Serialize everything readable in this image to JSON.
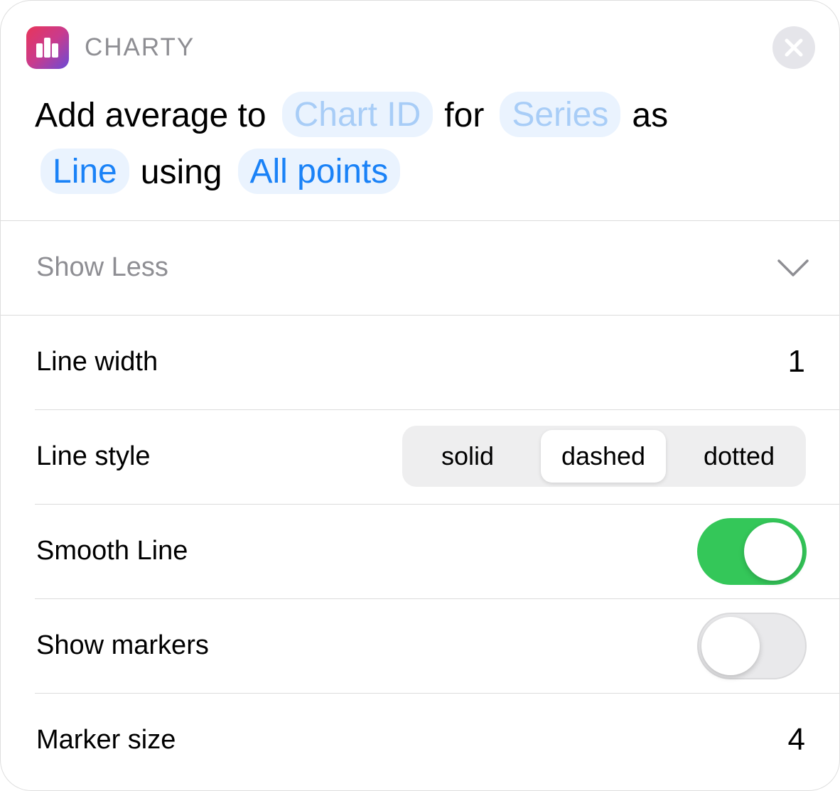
{
  "header": {
    "app_name": "CHARTY",
    "icon": "bar-chart-icon",
    "close_icon": "close-icon"
  },
  "sentence": {
    "word_add_average_to": "Add average to",
    "token_chart_id": "Chart ID",
    "word_for": "for",
    "token_series": "Series",
    "word_as": "as",
    "token_line": "Line",
    "word_using": "using",
    "token_all_points": "All points"
  },
  "show_less": {
    "label": "Show Less",
    "icon": "chevron-down-icon"
  },
  "rows": {
    "line_width": {
      "label": "Line width",
      "value": "1"
    },
    "line_style": {
      "label": "Line style",
      "options": [
        "solid",
        "dashed",
        "dotted"
      ],
      "selected": "dashed"
    },
    "smooth_line": {
      "label": "Smooth Line",
      "on": true
    },
    "show_markers": {
      "label": "Show markers",
      "on": false
    },
    "marker_size": {
      "label": "Marker size",
      "value": "4"
    }
  },
  "colors": {
    "accent": "#1a82f7",
    "placeholder": "#a8cdf7",
    "toggle_on": "#34c759",
    "secondary_text": "#8e8e93"
  }
}
